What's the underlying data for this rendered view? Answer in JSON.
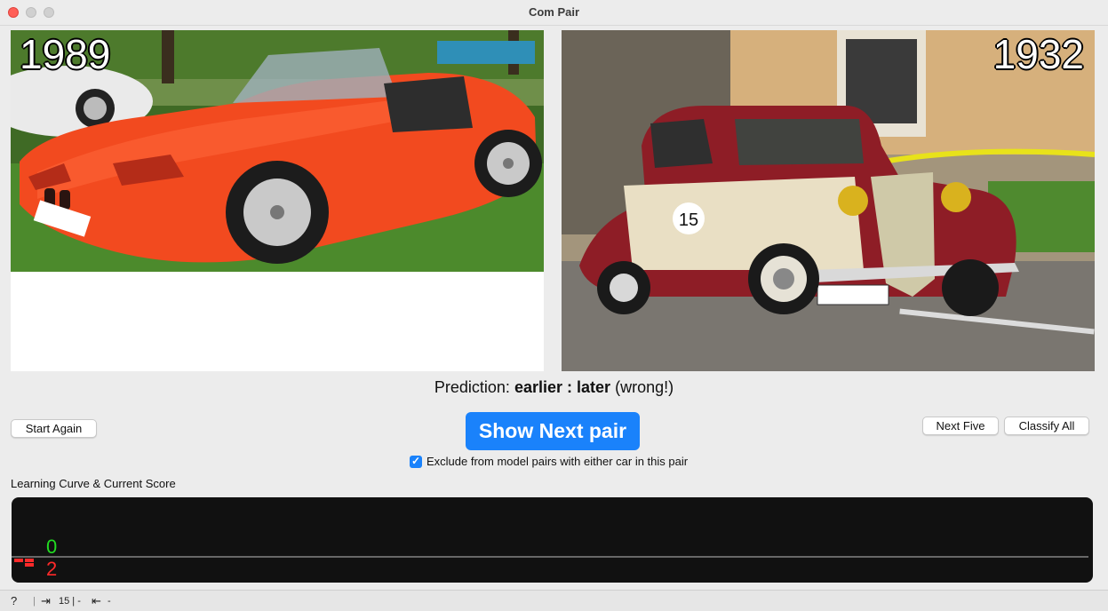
{
  "window": {
    "title": "Com Pair"
  },
  "left_car": {
    "year": "1989"
  },
  "right_car": {
    "year": "1932"
  },
  "prediction": {
    "prefix": "Prediction:",
    "first": "earlier",
    "separator": ":",
    "second": "later",
    "verdict": "(wrong!)"
  },
  "buttons": {
    "start_again": "Start Again",
    "show_next_pair": "Show Next pair",
    "next_five": "Next Five",
    "classify_all": "Classify All"
  },
  "exclude_option": {
    "label": "Exclude from model pairs with either car in this pair",
    "checked": true
  },
  "learning_curve": {
    "label": "Learning Curve & Current Score",
    "correct_count": "0",
    "wrong_count": "2",
    "correct_color": "#22dd22",
    "wrong_color": "#ff2a2a"
  },
  "status_bar": {
    "help_icon": "question-icon",
    "input_icon": "sign-in-icon",
    "input_text": "15 | -",
    "output_icon": "sign-out-icon",
    "output_text": "-"
  }
}
